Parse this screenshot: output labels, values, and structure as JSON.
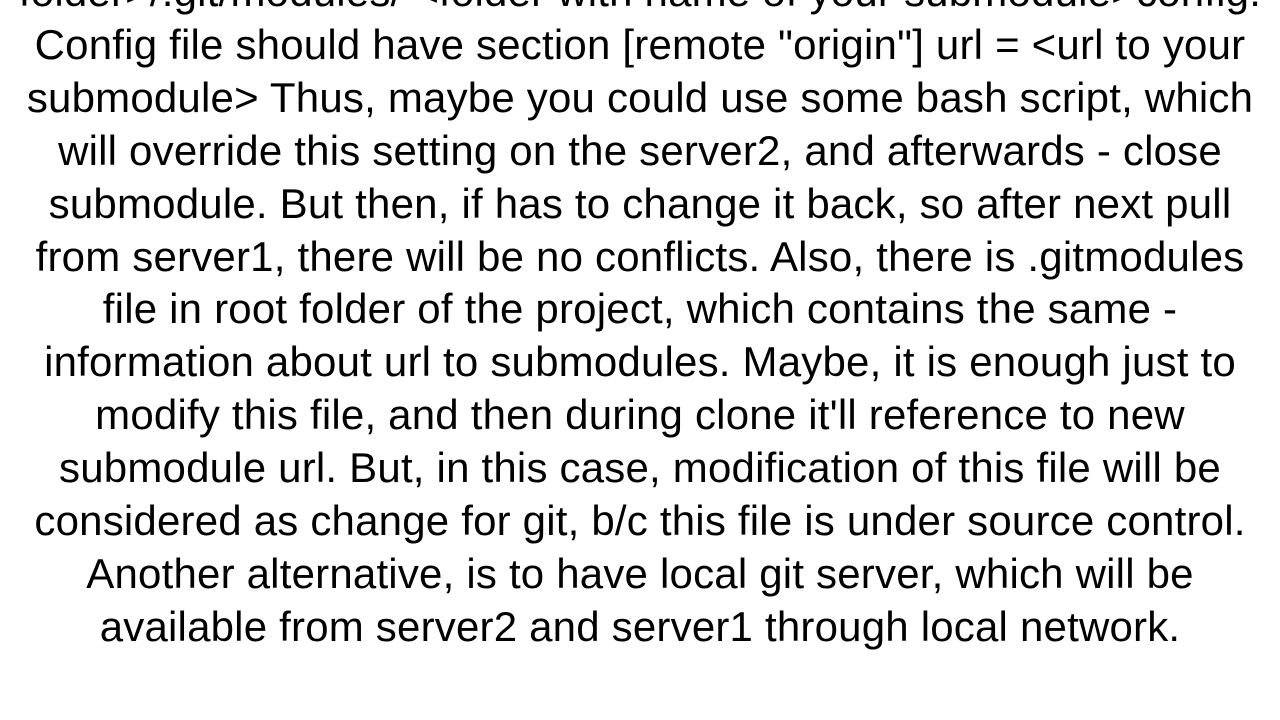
{
  "body": {
    "paragraph": "folder>/.git/modules/ <folder with name of your submodule>config. Config file should have section [remote \"origin\"] url = <url to your submodule>  Thus, maybe you could use some bash script, which will override this setting on the server2, and afterwards - close submodule. But then, if has to change it back, so after next pull from server1, there will be no conflicts. Also, there is .gitmodules file in root folder of the project, which contains the same - information about url to submodules. Maybe, it is enough just to modify this file, and then during clone it'll reference to new submodule url. But, in this case, modification of this file will be considered as change for git, b/c this file is under source control. Another alternative, is to have local git server, which will be available from server2 and server1 through local network."
  }
}
